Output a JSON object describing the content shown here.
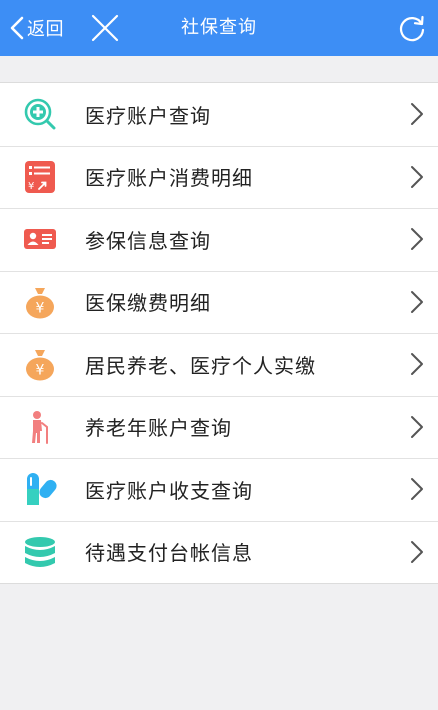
{
  "nav": {
    "back_label": "返回",
    "title": "社保查询",
    "bg_color": "#3d8ef5"
  },
  "menu": [
    {
      "label": "医疗账户查询",
      "icon": "medical-search-icon",
      "color": "#33c9ae"
    },
    {
      "label": "医疗账户消费明细",
      "icon": "expense-receipt-icon",
      "color": "#ef5a4f"
    },
    {
      "label": "参保信息查询",
      "icon": "id-card-icon",
      "color": "#ef5a4f"
    },
    {
      "label": "医保缴费明细",
      "icon": "money-bag-icon",
      "color": "#f5a65b"
    },
    {
      "label": "居民养老、医疗个人实缴",
      "icon": "money-bag-icon",
      "color": "#f5a65b"
    },
    {
      "label": "养老年账户查询",
      "icon": "elderly-person-icon",
      "color": "#f27f7f"
    },
    {
      "label": "医疗账户收支查询",
      "icon": "pill-capsule-icon",
      "color": "#2fb0f2"
    },
    {
      "label": "待遇支付台帐信息",
      "icon": "database-stack-icon",
      "color": "#33c9ae"
    }
  ]
}
